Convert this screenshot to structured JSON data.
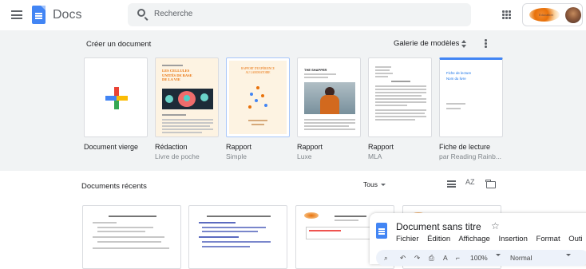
{
  "header": {
    "app_title": "Docs",
    "search_placeholder": "Recherche",
    "menu_icon": "hamburger-menu-icon",
    "apps_icon": "apps-grid-icon"
  },
  "templates": {
    "section_title": "Créer un document",
    "gallery_label": "Galerie de modèles",
    "items": [
      {
        "name": "Document vierge",
        "sub": ""
      },
      {
        "name": "Rédaction",
        "sub": "Livre de poche",
        "heading": "LES CELLULES\nUNITÉS DE BASE\nDE LA VIE"
      },
      {
        "name": "Rapport",
        "sub": "Simple",
        "heading": "RAPPORT D'EXPÉRIENCE\nAU LABORATOIRE"
      },
      {
        "name": "Rapport",
        "sub": "Luxe",
        "heading": "THE SHAPPER"
      },
      {
        "name": "Rapport",
        "sub": "MLA"
      },
      {
        "name": "Fiche de lecture",
        "sub": "par Reading Rainb...",
        "heading": "Fiche de lecture\nNom du livre"
      }
    ]
  },
  "recent": {
    "title": "Documents récents",
    "owner_filter": "Tous",
    "sort_label": "AZ"
  },
  "preview": {
    "doc_title": "Document sans titre",
    "menu": [
      "Fichier",
      "Édition",
      "Affichage",
      "Insertion",
      "Format",
      "Outi"
    ],
    "zoom": "100%",
    "style": "Normal"
  },
  "colors": {
    "accent_blue": "#4285f4",
    "band_bg": "#f1f3f4"
  }
}
